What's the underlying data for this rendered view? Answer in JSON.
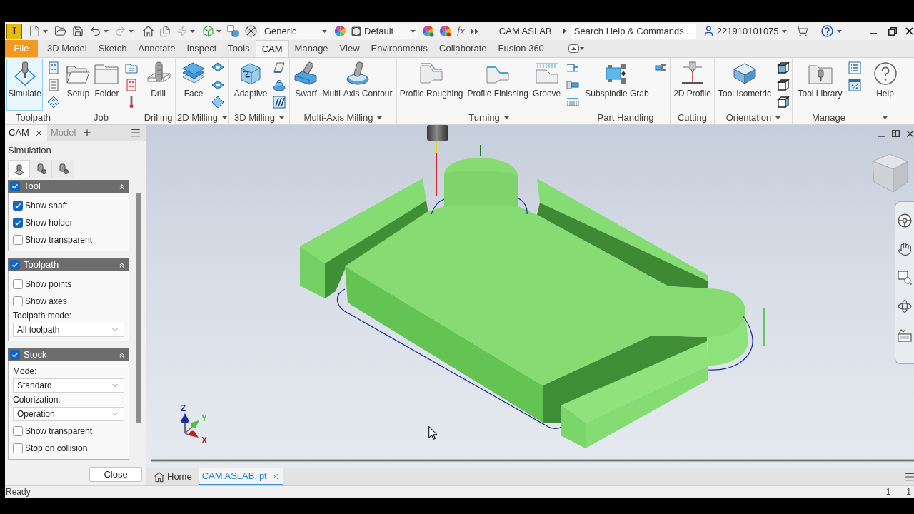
{
  "title_bar": {
    "app_letter": "I",
    "material": "Generic",
    "appearance": "Default",
    "formula_symbol": "fx",
    "document_title": "CAM ASLAB",
    "search": {
      "placeholder": "Search Help & Commands..."
    },
    "user": "221910101075"
  },
  "menu_tabs": [
    {
      "label": "File",
      "kind": "file",
      "selected": false
    },
    {
      "label": "3D Model",
      "kind": "tab",
      "selected": false
    },
    {
      "label": "Sketch",
      "kind": "tab",
      "selected": false
    },
    {
      "label": "Annotate",
      "kind": "tab",
      "selected": false
    },
    {
      "label": "Inspect",
      "kind": "tab",
      "selected": false
    },
    {
      "label": "Tools",
      "kind": "tab",
      "selected": false
    },
    {
      "label": "CAM",
      "kind": "tab",
      "selected": true
    },
    {
      "label": "Manage",
      "kind": "tab",
      "selected": false
    },
    {
      "label": "View",
      "kind": "tab",
      "selected": false
    },
    {
      "label": "Environments",
      "kind": "tab",
      "selected": false
    },
    {
      "label": "Collaborate",
      "kind": "tab",
      "selected": false
    },
    {
      "label": "Fusion 360",
      "kind": "tab",
      "selected": false
    }
  ],
  "ribbon": [
    {
      "label": "Toolpath",
      "dropdown": false,
      "tools": [
        {
          "label": "Simulate",
          "active": true
        }
      ]
    },
    {
      "label": "Job",
      "dropdown": false,
      "tools": [
        {
          "label": "Setup",
          "active": false
        },
        {
          "label": "Folder",
          "active": false
        }
      ]
    },
    {
      "label": "Drilling",
      "dropdown": false,
      "tools": [
        {
          "label": "Drill",
          "active": false
        }
      ]
    },
    {
      "label": "2D Milling",
      "dropdown": true,
      "tools": [
        {
          "label": "Face",
          "active": false
        }
      ]
    },
    {
      "label": "3D Milling",
      "dropdown": true,
      "tools": [
        {
          "label": "Adaptive",
          "active": false
        }
      ]
    },
    {
      "label": "Multi-Axis Milling",
      "dropdown": true,
      "tools": [
        {
          "label": "Swarf",
          "active": false
        },
        {
          "label": "Multi-Axis Contour",
          "active": false
        }
      ]
    },
    {
      "label": "Turning",
      "dropdown": true,
      "tools": [
        {
          "label": "Profile Roughing",
          "active": false
        },
        {
          "label": "Profile Finishing",
          "active": false
        },
        {
          "label": "Groove",
          "active": false
        }
      ]
    },
    {
      "label": "Part Handling",
      "dropdown": false,
      "tools": [
        {
          "label": "Subspindle Grab",
          "active": false
        }
      ]
    },
    {
      "label": "Cutting",
      "dropdown": false,
      "tools": [
        {
          "label": "2D Profile",
          "active": false
        }
      ]
    },
    {
      "label": "Orientation",
      "dropdown": true,
      "tools": [
        {
          "label": "Tool Isometric",
          "active": false
        }
      ]
    },
    {
      "label": "Manage",
      "dropdown": false,
      "tools": [
        {
          "label": "Tool Library",
          "active": false
        }
      ]
    },
    {
      "dropdown": true,
      "tools": [
        {
          "label": "Help",
          "active": false
        }
      ]
    }
  ],
  "browser": {
    "tabs": [
      {
        "label": "CAM",
        "selected": true,
        "closable": true
      },
      {
        "label": "Model",
        "selected": false,
        "closable": false
      }
    ],
    "title": "Simulation",
    "view_tabs": [
      {
        "selected": true
      },
      {
        "selected": false
      },
      {
        "selected": false
      }
    ],
    "sections": [
      {
        "title": "Tool",
        "enabled": true,
        "expanded": true,
        "items": [
          {
            "kind": "checkbox",
            "label": "Show shaft",
            "checked": true
          },
          {
            "kind": "checkbox",
            "label": "Show holder",
            "checked": true
          },
          {
            "kind": "checkbox",
            "label": "Show transparent",
            "checked": false
          }
        ]
      },
      {
        "title": "Toolpath",
        "enabled": true,
        "expanded": true,
        "items": [
          {
            "kind": "checkbox",
            "label": "Show points",
            "checked": false
          },
          {
            "kind": "checkbox",
            "label": "Show axes",
            "checked": false
          },
          {
            "kind": "select",
            "label": "Toolpath mode:",
            "value": "All toolpath"
          }
        ]
      },
      {
        "title": "Stock",
        "enabled": true,
        "expanded": true,
        "items": [
          {
            "kind": "select",
            "label": "Mode:",
            "value": "Standard"
          },
          {
            "kind": "select",
            "label": "Colorization:",
            "value": "Operation"
          },
          {
            "kind": "checkbox",
            "label": "Show transparent",
            "checked": false
          },
          {
            "kind": "checkbox",
            "label": "Stop on collision",
            "checked": false
          }
        ]
      }
    ],
    "close_button": "Close"
  },
  "viewport": {
    "axis_labels": [
      {
        "label": "Z",
        "color": "#1f2a9e"
      },
      {
        "label": "Y",
        "color": "#4cc43c"
      },
      {
        "label": "X",
        "color": "#c41e24"
      }
    ]
  },
  "document_tabs": [
    {
      "label": "Home",
      "kind": "home",
      "selected": false,
      "closable": false
    },
    {
      "label": "CAM ASLAB.ipt",
      "kind": "document",
      "selected": true,
      "closable": true
    }
  ],
  "status_bar": {
    "message": "Ready",
    "counters": [
      "1",
      "1"
    ]
  }
}
